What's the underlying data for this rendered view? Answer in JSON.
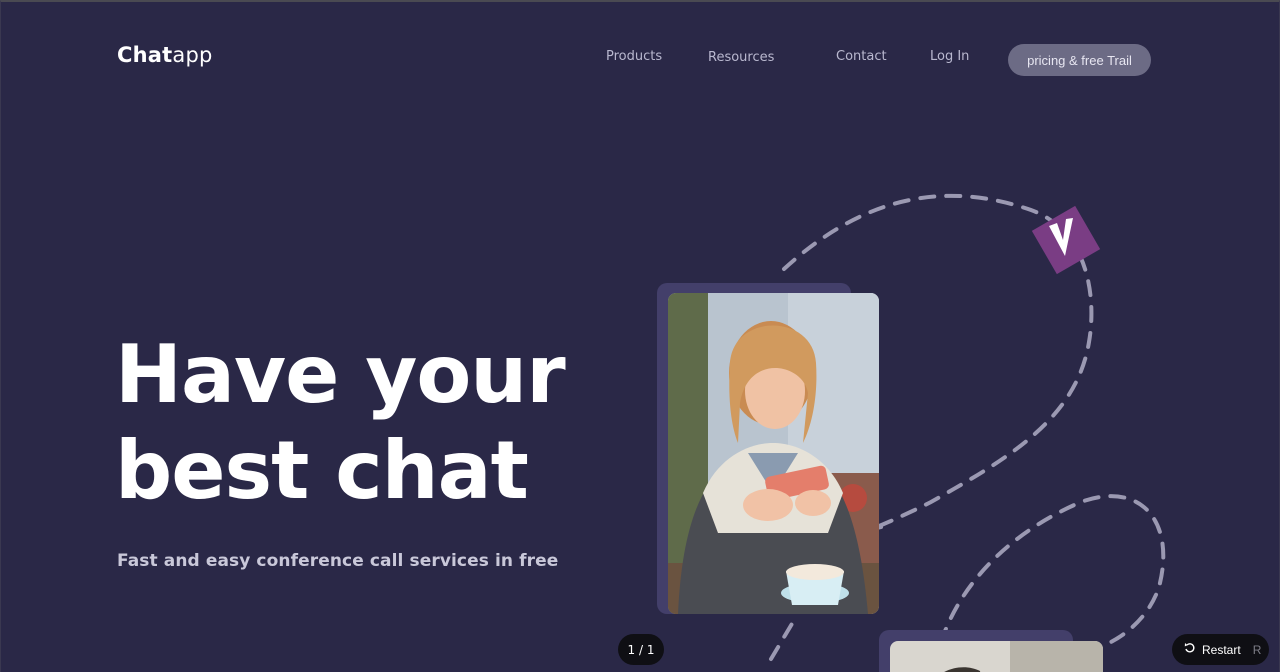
{
  "brand": {
    "bold": "Chat",
    "light": "app"
  },
  "nav": {
    "products": "Products",
    "resources": "Resources",
    "contact": "Contact",
    "login": "Log In",
    "cta": "pricing & free Trail"
  },
  "hero": {
    "line1": "Have your",
    "line2": "best chat",
    "subtitle": "Fast and easy conference call services in free"
  },
  "pager": "1 / 1",
  "restart": {
    "label": "Restart",
    "key": "R"
  },
  "colors": {
    "background": "#2a2847",
    "accent_badge": "#7a3d84",
    "dash": "#9b99b2",
    "cta_bg": "#6c6b85"
  },
  "icons": {
    "badge": "v-logo-icon",
    "restart": "restart-icon"
  }
}
